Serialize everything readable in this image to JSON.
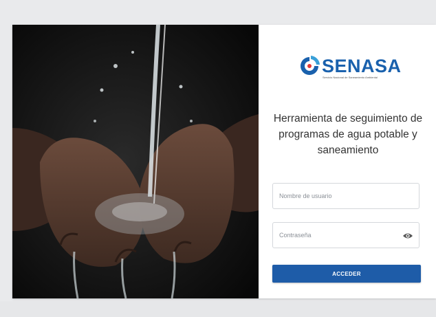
{
  "brand": {
    "name": "SENASA",
    "subtitle": "Servicio Nacional de Saneamiento Ambiental",
    "logo_icon": "swirl-logo-icon",
    "color": "#1a61ad"
  },
  "login": {
    "heading": "Herramienta de seguimiento de programas de agua potable y saneamiento",
    "username_placeholder": "Nombre de usuario",
    "password_placeholder": "Contraseña",
    "password_toggle_icon": "eye-icon",
    "submit_label": "ACCEDER",
    "button_color": "#1e5ca8"
  },
  "hero_image": {
    "subject": "hands-water-photo"
  }
}
